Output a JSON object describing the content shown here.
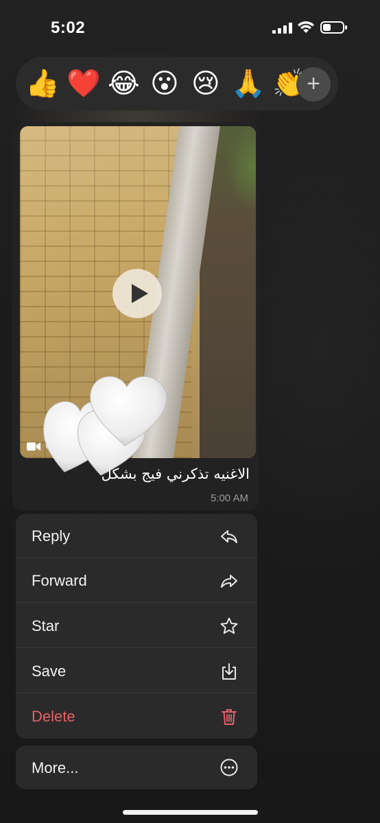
{
  "status_bar": {
    "time": "5:02",
    "icons": [
      "signal-icon",
      "wifi-icon",
      "battery-icon"
    ]
  },
  "reactions": {
    "emojis": [
      "👍",
      "❤️",
      "😂",
      "😮",
      "😢",
      "🙏",
      "👏"
    ],
    "add_label": "+"
  },
  "message": {
    "video_duration": "0:1",
    "caption": "الاغنيه تذكرني فيج بشكل",
    "timestamp": "5:00 AM",
    "sticker": "white-hearts-sticker"
  },
  "menu": {
    "items": [
      {
        "label": "Reply",
        "icon": "reply-icon"
      },
      {
        "label": "Forward",
        "icon": "forward-icon"
      },
      {
        "label": "Star",
        "icon": "star-icon"
      },
      {
        "label": "Save",
        "icon": "save-icon"
      },
      {
        "label": "Delete",
        "icon": "trash-icon",
        "color": "#e5626a"
      }
    ],
    "more": {
      "label": "More...",
      "icon": "more-icon"
    }
  }
}
